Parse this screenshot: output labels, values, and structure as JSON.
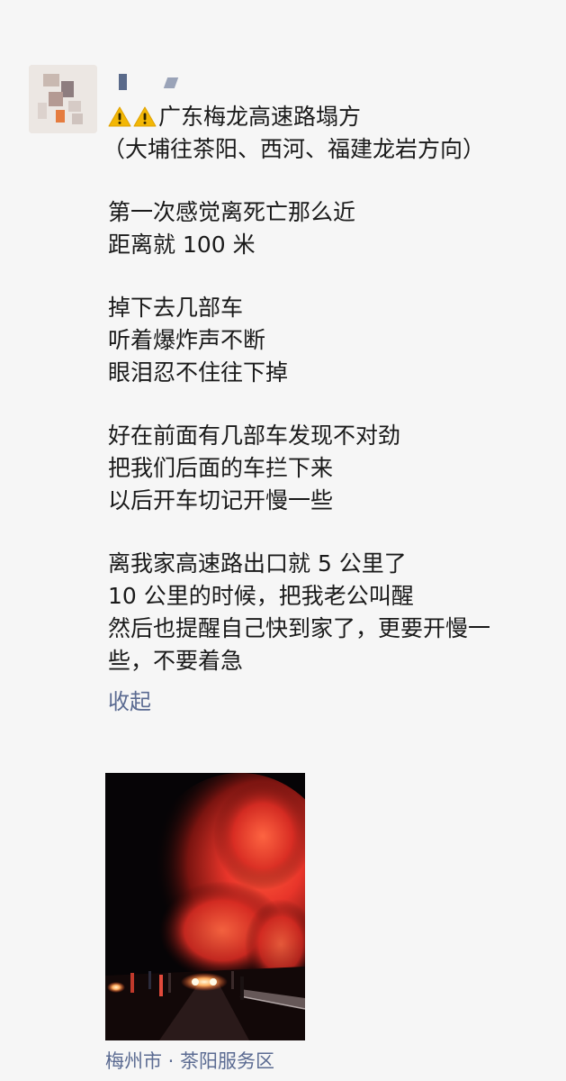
{
  "post": {
    "title": "广东梅龙高速路塌方",
    "subtitle": "（大埔往茶阳、西河、福建龙岩方向）",
    "paragraphs": [
      [
        "第一次感觉离死亡那么近",
        "距离就 100 米"
      ],
      [
        "掉下去几部车",
        "听着爆炸声不断",
        "眼泪忍不住往下掉"
      ],
      [
        "好在前面有几部车发现不对劲",
        "把我们后面的车拦下来",
        "以后开车切记开慢一些"
      ],
      [
        "离我家高速路出口就 5 公里了",
        "10 公里的时候，把我老公叫醒",
        "然后也提醒自己快到家了，更要开慢一",
        "些，不要着急"
      ]
    ],
    "collapse_label": "收起",
    "location": "梅州市 · 茶阳服务区"
  },
  "icons": {
    "title_prefix": [
      "warning-icon",
      "warning-icon"
    ]
  },
  "colors": {
    "link": "#5b6b92",
    "warning": "#f2b705",
    "background": "#f6f6f6",
    "text": "#1a1a1a"
  }
}
